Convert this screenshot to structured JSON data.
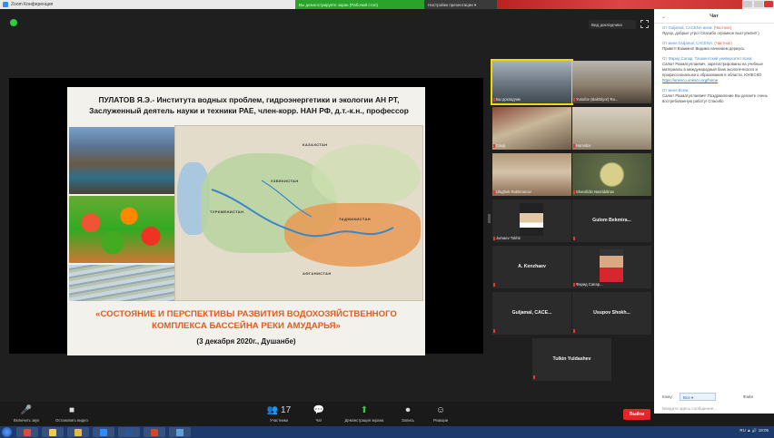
{
  "window": {
    "title": "Zoom Конференция",
    "share_banner": "Вы демонстрируете экран (Рабочий стол)",
    "share_settings": "Настройки презентации ▾"
  },
  "meeting": {
    "view_button": "Вид докладчика",
    "colors": {
      "accent_green": "#2ecc40",
      "leave_red": "#e02828",
      "active_tile": "#f5d800"
    }
  },
  "slide": {
    "author": "ПУЛАТОВ Я.Э.- Института водных проблем, гидроэнергетики и экологии АН РТ, Заслуженный деятель науки и техники РАЕ, член-корр. НАН РФ, д.т.-к.н., профессор",
    "title": "«СОСТОЯНИЕ И ПЕРСПЕКТИВЫ РАЗВИТИЯ ВОДОХОЗЯЙСТВЕННОГО КОМПЛЕКСА БАССЕЙНА РЕКИ АМУДАРЬЯ»",
    "date": "(3 декабря 2020г., Душанбе)",
    "map_labels": [
      "КАЗАХСТАН",
      "УЗБЕКИСТАН",
      "ТУРКМЕНИСТАН",
      "ТАДЖИКИСТАН",
      "АФГАНИСТАН"
    ]
  },
  "participants": [
    {
      "name": "Вы докладчик",
      "label": ""
    },
    {
      "name": "Yusufov (Bakhtiyor) Ra...",
      "label": ""
    },
    {
      "name": "Саид",
      "label": ""
    },
    {
      "name": "Hamidov",
      "label": ""
    },
    {
      "name": "Ulugbek Rakhmanov",
      "label": ""
    },
    {
      "name": "Sharofidin Nasriddinov",
      "label": ""
    },
    {
      "name": "Jumaev Tokhir",
      "label": ""
    },
    {
      "name": "",
      "label": "Gulom Bekmira..."
    },
    {
      "name": "",
      "label": "A. Kenzhaev"
    },
    {
      "name": "Фарид Сапар...",
      "label": ""
    },
    {
      "name": "",
      "label": "Guljamal, CACE..."
    },
    {
      "name": "",
      "label": "Usupov Shokh..."
    },
    {
      "name": "",
      "label": "Tulkin Yuldashev"
    }
  ],
  "chat": {
    "title": "Чат",
    "messages": [
      {
        "from": "От Guljamal, CACENA всем:",
        "priv": "(Частное)",
        "text": "Ядгор, добрые утро! Спасибо огромное выступили!! )",
        "link": ""
      },
      {
        "from": "От меня Guljamal, CACENA:",
        "priv": "(Частное)",
        "text": "Привет! Взаимно! Видимо начинаем держусь",
        "link": ""
      },
      {
        "from": "От Фарид Сапар, Ташкентский университет всем:",
        "priv": "",
        "text": "Салют Разматуллаевич, зарегистрированы на учебные материалы в международный банк экологического и профессионального образования в области. ЮНЕСКО",
        "link": "https://unesco.unesco.org/home"
      },
      {
        "from": "От меня Всем:",
        "priv": "",
        "text": "Салют Разматуллаевич! Поздравление Вы делаете очень востребованную работу! Спасибо",
        "link": ""
      }
    ],
    "to_label": "Кому:",
    "to_value": "Все ▾",
    "file_label": "Файл",
    "input_placeholder": "Введите здесь сообщение..."
  },
  "toolbar": {
    "items": [
      {
        "icon": "🎤",
        "label": "Включить звук"
      },
      {
        "icon": "■",
        "label": "Остановить видео"
      },
      {
        "icon": "👥 17",
        "label": "Участники"
      },
      {
        "icon": "💬",
        "label": "Чат"
      },
      {
        "icon": "⬆",
        "label": "Демонстрация экрана"
      },
      {
        "icon": "⏺",
        "label": "Запись"
      },
      {
        "icon": "☺",
        "label": "Реакции"
      }
    ],
    "leave": "Выйти"
  },
  "taskbar": {
    "tray_text": "RU  ▲  🔊  18:05"
  }
}
